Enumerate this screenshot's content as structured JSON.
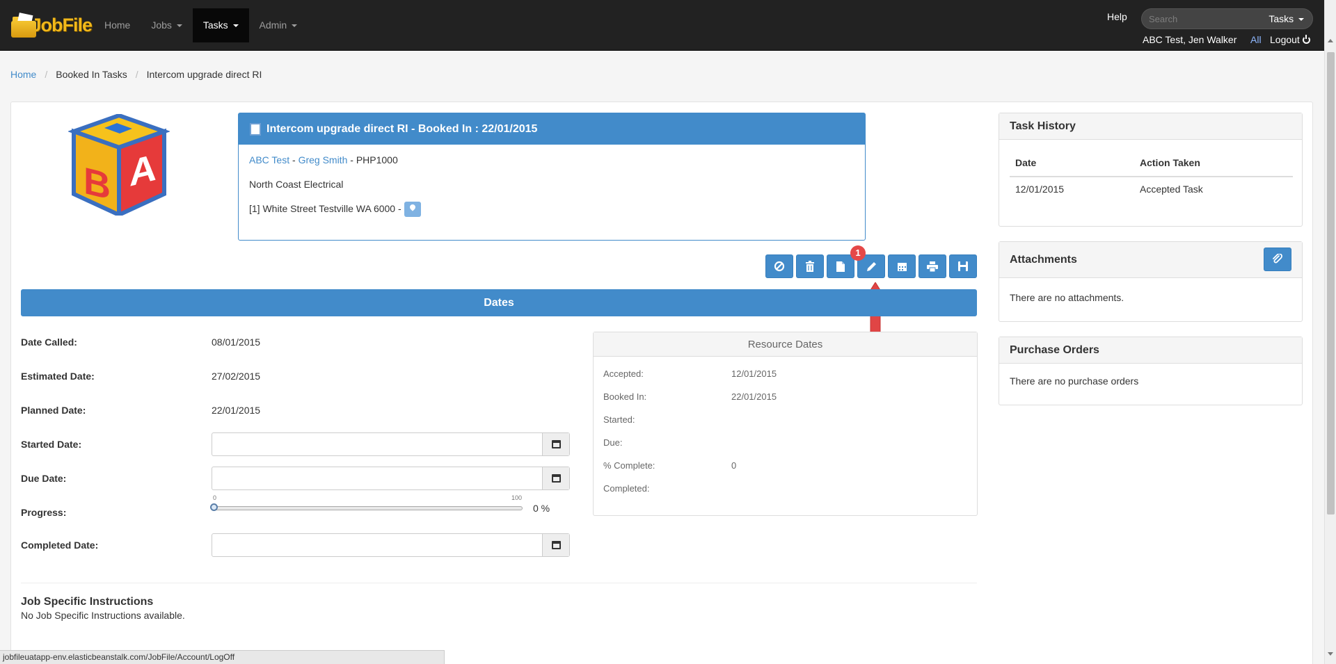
{
  "nav": {
    "brand": "JobFile",
    "items": [
      "Home",
      "Jobs",
      "Tasks",
      "Admin"
    ],
    "help": "Help",
    "search_placeholder": "Search",
    "search_scope": "Tasks",
    "user": "ABC Test, Jen Walker",
    "all": "All",
    "logout": "Logout"
  },
  "breadcrumb": [
    "Home",
    "Booked In Tasks",
    "Intercom upgrade direct RI"
  ],
  "task": {
    "title": "Intercom upgrade direct RI - Booked In : 22/01/2015",
    "client": "ABC Test",
    "contact": "Greg Smith",
    "ref": "- PHP1000",
    "dash": "-",
    "company": "North Coast Electrical",
    "address": "[1] White Street Testville WA 6000 -"
  },
  "toolbar": {
    "badge": "1",
    "buttons": [
      "cancel-icon",
      "trash-icon",
      "file-icon",
      "pencil-icon",
      "calendar-icon",
      "print-icon",
      "save-icon"
    ]
  },
  "dates": {
    "header": "Dates",
    "date_called_label": "Date Called:",
    "date_called": "08/01/2015",
    "estimated_label": "Estimated Date:",
    "estimated": "27/02/2015",
    "planned_label": "Planned Date:",
    "planned": "22/01/2015",
    "started_label": "Started Date:",
    "started": "",
    "due_label": "Due Date:",
    "due": "",
    "progress_label": "Progress:",
    "progress_min": "0",
    "progress_max": "100",
    "progress_value": 0,
    "progress_text": "0 %",
    "completed_label": "Completed Date:",
    "completed": ""
  },
  "resource": {
    "title": "Resource Dates",
    "rows": [
      {
        "label": "Accepted:",
        "value": "12/01/2015"
      },
      {
        "label": "Booked In:",
        "value": "22/01/2015"
      },
      {
        "label": "Started:",
        "value": ""
      },
      {
        "label": "Due:",
        "value": ""
      },
      {
        "label": "% Complete:",
        "value": "0"
      },
      {
        "label": "Completed:",
        "value": ""
      }
    ]
  },
  "instructions": {
    "title": "Job Specific Instructions",
    "text": "No Job Specific Instructions available."
  },
  "history": {
    "title": "Task History",
    "col_date": "Date",
    "col_action": "Action Taken",
    "rows": [
      {
        "date": "12/01/2015",
        "action": "Accepted Task"
      }
    ]
  },
  "attachments": {
    "title": "Attachments",
    "empty": "There are no attachments."
  },
  "purchase_orders": {
    "title": "Purchase Orders",
    "empty": "There are no purchase orders"
  },
  "status_url": "jobfileuatapp-env.elasticbeanstalk.com/JobFile/Account/LogOff",
  "colors": {
    "primary": "#428bca",
    "navbar": "#222222",
    "badge": "#e54848",
    "arrow": "#e04545"
  }
}
